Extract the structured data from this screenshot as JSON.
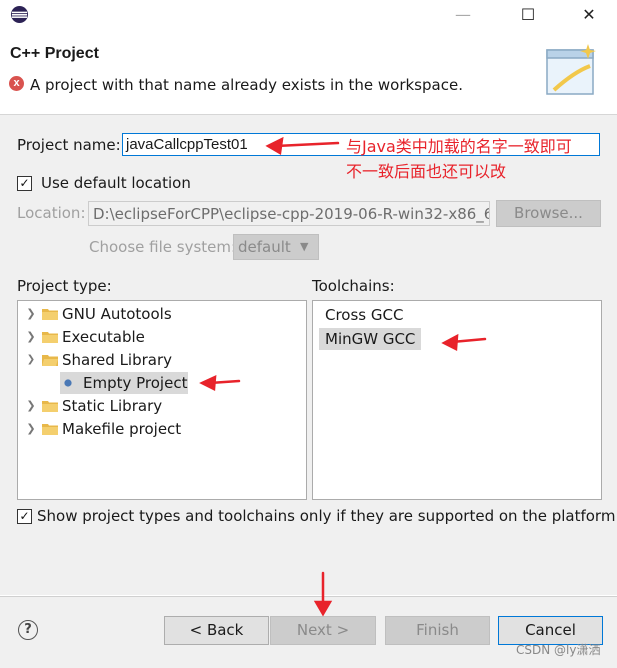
{
  "window": {
    "minimize_glyph": "—",
    "maximize_glyph": "☐",
    "close_glyph": "✕"
  },
  "header": {
    "title": "C++ Project",
    "error_glyph": "x",
    "error_message": "A project with that name already exists in the workspace."
  },
  "form": {
    "project_name_label": "Project name:",
    "project_name_value": "javaCallcppTest01",
    "use_default_location_label": "Use default location",
    "use_default_location_checked": true,
    "location_label": "Location:",
    "location_value": "D:\\eclipseForCPP\\eclipse-cpp-2019-06-R-win32-x86_6",
    "browse_label": "Browse...",
    "file_system_label": "Choose file system:",
    "file_system_value": "default"
  },
  "project_type": {
    "label": "Project type:",
    "items": [
      {
        "label": "GNU Autotools",
        "expanded": false
      },
      {
        "label": "Executable",
        "expanded": false
      },
      {
        "label": "Shared Library",
        "expanded": true
      },
      {
        "label": "Empty Project",
        "child": true,
        "selected": true
      },
      {
        "label": "Static Library",
        "expanded": false
      },
      {
        "label": "Makefile project",
        "expanded": false
      }
    ]
  },
  "toolchains": {
    "label": "Toolchains:",
    "items": [
      {
        "label": "Cross GCC",
        "selected": false
      },
      {
        "label": "MinGW GCC",
        "selected": true
      }
    ]
  },
  "show_supported": {
    "label": "Show project types and toolchains only if they are supported on the platform",
    "checked": true
  },
  "footer": {
    "help_glyph": "?",
    "back_label": "< Back",
    "next_label": "Next >",
    "finish_label": "Finish",
    "cancel_label": "Cancel"
  },
  "annotations": {
    "line1": "与Java类中加载的名字一致即可",
    "line2": "不一致后面也还可以改",
    "arrow_color": "#e8232b"
  },
  "watermark": "CSDN @ly潇洒",
  "colors": {
    "accent": "#0078d7",
    "error": "#d9534f",
    "folder": "#e8b84a"
  }
}
